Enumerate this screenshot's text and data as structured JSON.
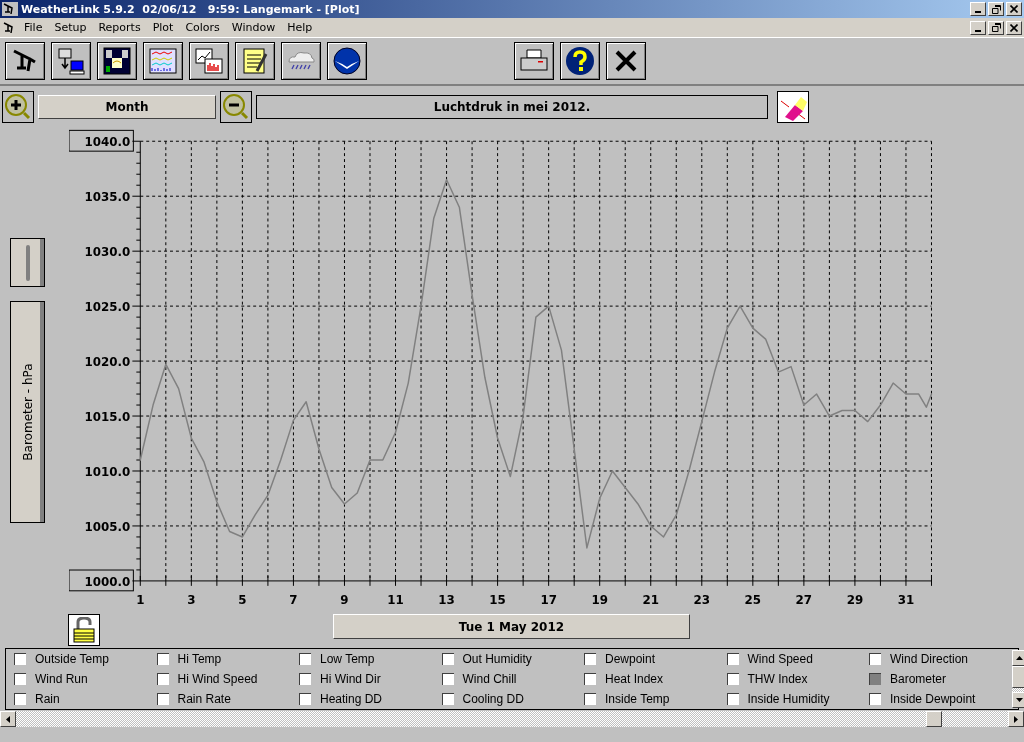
{
  "window": {
    "title": "WeatherLink 5.9.2  02/06/12   9:59: Langemark - [Plot]"
  },
  "menu": [
    "File",
    "Setup",
    "Reports",
    "Plot",
    "Colors",
    "Window",
    "Help"
  ],
  "period_button": "Month",
  "chart_data": {
    "type": "line",
    "title": "Luchtdruk in mei 2012.",
    "ylabel": "Barometer - hPa",
    "xlim": [
      1,
      32
    ],
    "ylim": [
      1000,
      1040
    ],
    "xticks": [
      1,
      3,
      5,
      7,
      9,
      11,
      13,
      15,
      17,
      19,
      21,
      23,
      25,
      27,
      29,
      31
    ],
    "yticks": [
      {
        "value": 1040,
        "label": "1040.0"
      },
      {
        "value": 1035,
        "label": "1035.0"
      },
      {
        "value": 1030,
        "label": "1030.0"
      },
      {
        "value": 1025,
        "label": "1025.0"
      },
      {
        "value": 1020,
        "label": "1020.0"
      },
      {
        "value": 1015,
        "label": "1015.0"
      },
      {
        "value": 1010,
        "label": "1010.0"
      },
      {
        "value": 1005,
        "label": "1005.0"
      },
      {
        "value": 1000,
        "label": "1000.0"
      }
    ],
    "x": [
      1,
      1.5,
      2,
      2.5,
      3,
      3.5,
      4,
      4.5,
      5,
      5.5,
      6,
      6.5,
      7,
      7.5,
      8,
      8.5,
      9,
      9.5,
      10,
      10.5,
      11,
      11.5,
      12,
      12.5,
      13,
      13.5,
      14,
      14.5,
      15,
      15.5,
      16,
      16.5,
      17,
      17.5,
      18,
      18.5,
      19,
      19.5,
      20,
      20.5,
      21,
      21.5,
      22,
      22.5,
      23,
      23.5,
      24,
      24.5,
      25,
      25.5,
      26,
      26.5,
      27,
      27.5,
      28,
      28.5,
      29,
      29.5,
      30,
      30.5,
      31,
      31.5,
      31.8,
      32
    ],
    "grid": true,
    "series": [
      {
        "color": "#808080",
        "values": [
          1011,
          1016,
          1019.7,
          1017.5,
          1013,
          1010.8,
          1007.2,
          1004.5,
          1004,
          1006,
          1007.8,
          1011,
          1014.6,
          1016.3,
          1012,
          1008.5,
          1007,
          1008,
          1011,
          1011,
          1013.5,
          1018,
          1025,
          1033,
          1036.5,
          1034,
          1026,
          1018.5,
          1013,
          1009.5,
          1015,
          1024,
          1025,
          1021,
          1012,
          1003,
          1007.5,
          1010,
          1008.5,
          1007,
          1005,
          1004,
          1006,
          1010,
          1014.5,
          1019,
          1023,
          1025,
          1023,
          1022,
          1019,
          1019.5,
          1016,
          1017,
          1015,
          1015.5,
          1015.5,
          1014.5,
          1016,
          1018,
          1017,
          1017,
          1015.8,
          1017
        ]
      }
    ]
  },
  "date_button": "Tue 1 May 2012",
  "fields": [
    {
      "label": "Outside Temp",
      "checked": false
    },
    {
      "label": "Hi Temp",
      "checked": false
    },
    {
      "label": "Low Temp",
      "checked": false
    },
    {
      "label": "Out Humidity",
      "checked": false
    },
    {
      "label": "Dewpoint",
      "checked": false
    },
    {
      "label": "Wind Speed",
      "checked": false
    },
    {
      "label": "Wind Direction",
      "checked": false
    },
    {
      "label": "Wind Run",
      "checked": false
    },
    {
      "label": "Hi Wind Speed",
      "checked": false
    },
    {
      "label": "Hi Wind Dir",
      "checked": false
    },
    {
      "label": "Wind Chill",
      "checked": false
    },
    {
      "label": "Heat Index",
      "checked": false
    },
    {
      "label": "THW Index",
      "checked": false
    },
    {
      "label": "Barometer",
      "checked": true
    },
    {
      "label": "Rain",
      "checked": false
    },
    {
      "label": "Rain Rate",
      "checked": false
    },
    {
      "label": "Heating DD",
      "checked": false
    },
    {
      "label": "Cooling DD",
      "checked": false
    },
    {
      "label": "Inside Temp",
      "checked": false
    },
    {
      "label": "Inside Humidity",
      "checked": false
    },
    {
      "label": "Inside Dewpoint",
      "checked": false
    }
  ]
}
